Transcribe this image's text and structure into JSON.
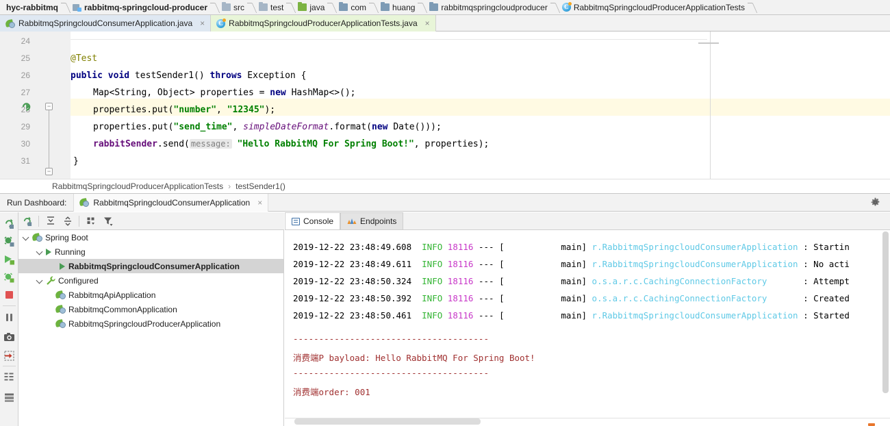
{
  "navbar": {
    "items": [
      {
        "label": "hyc-rabbitmq",
        "icon": "project-icon",
        "bold": true,
        "icon_type": "none"
      },
      {
        "label": "rabbitmq-springcloud-producer",
        "icon": "module-icon",
        "bold": true,
        "icon_type": "module"
      },
      {
        "label": "src",
        "icon": "folder-icon",
        "bold": false,
        "icon_type": "folder"
      },
      {
        "label": "test",
        "icon": "folder-icon",
        "bold": false,
        "icon_type": "folder"
      },
      {
        "label": "java",
        "icon": "source-folder-icon",
        "bold": false,
        "icon_type": "folder-green"
      },
      {
        "label": "com",
        "icon": "package-icon",
        "bold": false,
        "icon_type": "folder-blue"
      },
      {
        "label": "huang",
        "icon": "package-icon",
        "bold": false,
        "icon_type": "folder-blue"
      },
      {
        "label": "rabbitmqspringcloudproducer",
        "icon": "package-icon",
        "bold": false,
        "icon_type": "folder-blue"
      },
      {
        "label": "RabbitmqSpringcloudProducerApplicationTests",
        "icon": "java-class-icon",
        "bold": false,
        "icon_type": "class"
      }
    ]
  },
  "editor_tabs": [
    {
      "label": "RabbitmqSpringcloudConsumerApplication.java",
      "icon": "spring-boot-class-icon",
      "active": false,
      "close": "×"
    },
    {
      "label": "RabbitmqSpringcloudProducerApplicationTests.java",
      "icon": "java-test-class-icon",
      "active": true,
      "close": "×"
    }
  ],
  "editor": {
    "first_visible_line": 24,
    "highlighted_line": 28,
    "line_numbers": [
      "24",
      "25",
      "26",
      "27",
      "28",
      "29",
      "30",
      "31"
    ],
    "code_lines": [
      {
        "line": "24",
        "text": ""
      },
      {
        "line": "25",
        "text": "    @Test"
      },
      {
        "line": "26",
        "text": "    public void testSender1() throws Exception {"
      },
      {
        "line": "27",
        "text": "        Map<String, Object> properties = new HashMap<>();"
      },
      {
        "line": "28",
        "text": "        properties.put(\"number\", \"12345\");"
      },
      {
        "line": "29",
        "text": "        properties.put(\"send_time\", simpleDateFormat.format(new Date()));"
      },
      {
        "line": "30",
        "text": "        rabbitSender.send( message: \"Hello RabbitMQ For Spring Boot!\", properties);"
      },
      {
        "line": "31",
        "text": "    }"
      }
    ],
    "inlay_hint": "message:"
  },
  "editor_breadcrumb": {
    "class": "RabbitmqSpringcloudProducerApplicationTests",
    "separator": "›",
    "method": "testSender1()"
  },
  "run_dashboard": {
    "label": "Run Dashboard:",
    "tab_label": "RabbitmqSpringcloudConsumerApplication",
    "tab_close": "×",
    "settings_icon": "gear-icon",
    "toolbar_buttons": [
      {
        "name": "rerun-icon"
      },
      {
        "name": "expand-all-icon"
      },
      {
        "name": "collapse-all-icon"
      },
      {
        "name": "group-by-icon"
      },
      {
        "name": "filter-icon"
      }
    ],
    "tree": [
      {
        "label": "Spring Boot",
        "depth": 0,
        "chevron": true,
        "icon": "spring-boot-icon",
        "selected": false
      },
      {
        "label": "Running",
        "depth": 1,
        "chevron": true,
        "icon": "play-icon",
        "selected": false
      },
      {
        "label": "RabbitmqSpringcloudConsumerApplication",
        "depth": 2,
        "chevron": false,
        "icon": "play-icon",
        "selected": true
      },
      {
        "label": "Configured",
        "depth": 1,
        "chevron": true,
        "icon": "wrench-icon",
        "selected": false
      },
      {
        "label": "RabbitmqApiApplication",
        "depth": 2,
        "chevron": false,
        "icon": "spring-boot-icon",
        "selected": false
      },
      {
        "label": "RabbitmqCommonApplication",
        "depth": 2,
        "chevron": false,
        "icon": "spring-boot-icon",
        "selected": false
      },
      {
        "label": "RabbitmqSpringcloudProducerApplication",
        "depth": 2,
        "chevron": false,
        "icon": "spring-boot-icon",
        "selected": false
      }
    ]
  },
  "vertical_toolbar": [
    {
      "name": "rerun-icon"
    },
    {
      "name": "debug-rerun-icon"
    },
    {
      "name": "run-icon"
    },
    {
      "name": "debug-icon"
    },
    {
      "name": "stop-icon"
    },
    {
      "name": "pause-icon"
    },
    {
      "name": "camera-icon"
    },
    {
      "name": "export-icon"
    },
    {
      "name": "soft-wrap-icon"
    },
    {
      "name": "print-icon"
    }
  ],
  "console_tabs": [
    {
      "label": "Console",
      "icon": "console-icon",
      "active": true
    },
    {
      "label": "Endpoints",
      "icon": "endpoints-icon",
      "active": false
    }
  ],
  "console_output": [
    {
      "timestamp": "2019-12-22 23:48:49.608",
      "level": "INFO",
      "pid": "18116",
      "dash": "---",
      "thread": "[           main]",
      "logger": "r.RabbitmqSpringcloudConsumerApplication",
      "colon": ":",
      "message": "Startin"
    },
    {
      "timestamp": "2019-12-22 23:48:49.611",
      "level": "INFO",
      "pid": "18116",
      "dash": "---",
      "thread": "[           main]",
      "logger": "r.RabbitmqSpringcloudConsumerApplication",
      "colon": ":",
      "message": "No acti"
    },
    {
      "timestamp": "2019-12-22 23:48:50.324",
      "level": "INFO",
      "pid": "18116",
      "dash": "---",
      "thread": "[           main]",
      "logger": "o.s.a.r.c.CachingConnectionFactory",
      "colon": ":",
      "message": "Attempt"
    },
    {
      "timestamp": "2019-12-22 23:48:50.392",
      "level": "INFO",
      "pid": "18116",
      "dash": "---",
      "thread": "[           main]",
      "logger": "o.s.a.r.c.CachingConnectionFactory",
      "colon": ":",
      "message": "Created"
    },
    {
      "timestamp": "2019-12-22 23:48:50.461",
      "level": "INFO",
      "pid": "18116",
      "dash": "---",
      "thread": "[           main]",
      "logger": "r.RabbitmqSpringcloudConsumerApplication",
      "colon": ":",
      "message": "Started"
    }
  ],
  "console_extra": [
    {
      "text": "--------------------------------------",
      "color": "red"
    },
    {
      "text": "消费端P bayload: Hello RabbitMQ For Spring Boot!",
      "color": "red"
    },
    {
      "text": "--------------------------------------",
      "color": "red"
    },
    {
      "text": "消费端order: 001",
      "color": "red"
    }
  ],
  "colors": {
    "accent_green": "#6db33f",
    "keyword_blue": "#000080",
    "string_green": "#008000",
    "field_purple": "#660e7a",
    "log_info_green": "#33b433",
    "log_pid_magenta": "#c838c8",
    "log_logger_cyan": "#5fc9e6",
    "console_red": "#a03030",
    "highlight_line": "#fffae3",
    "selection_gray": "#d4d4d4"
  }
}
